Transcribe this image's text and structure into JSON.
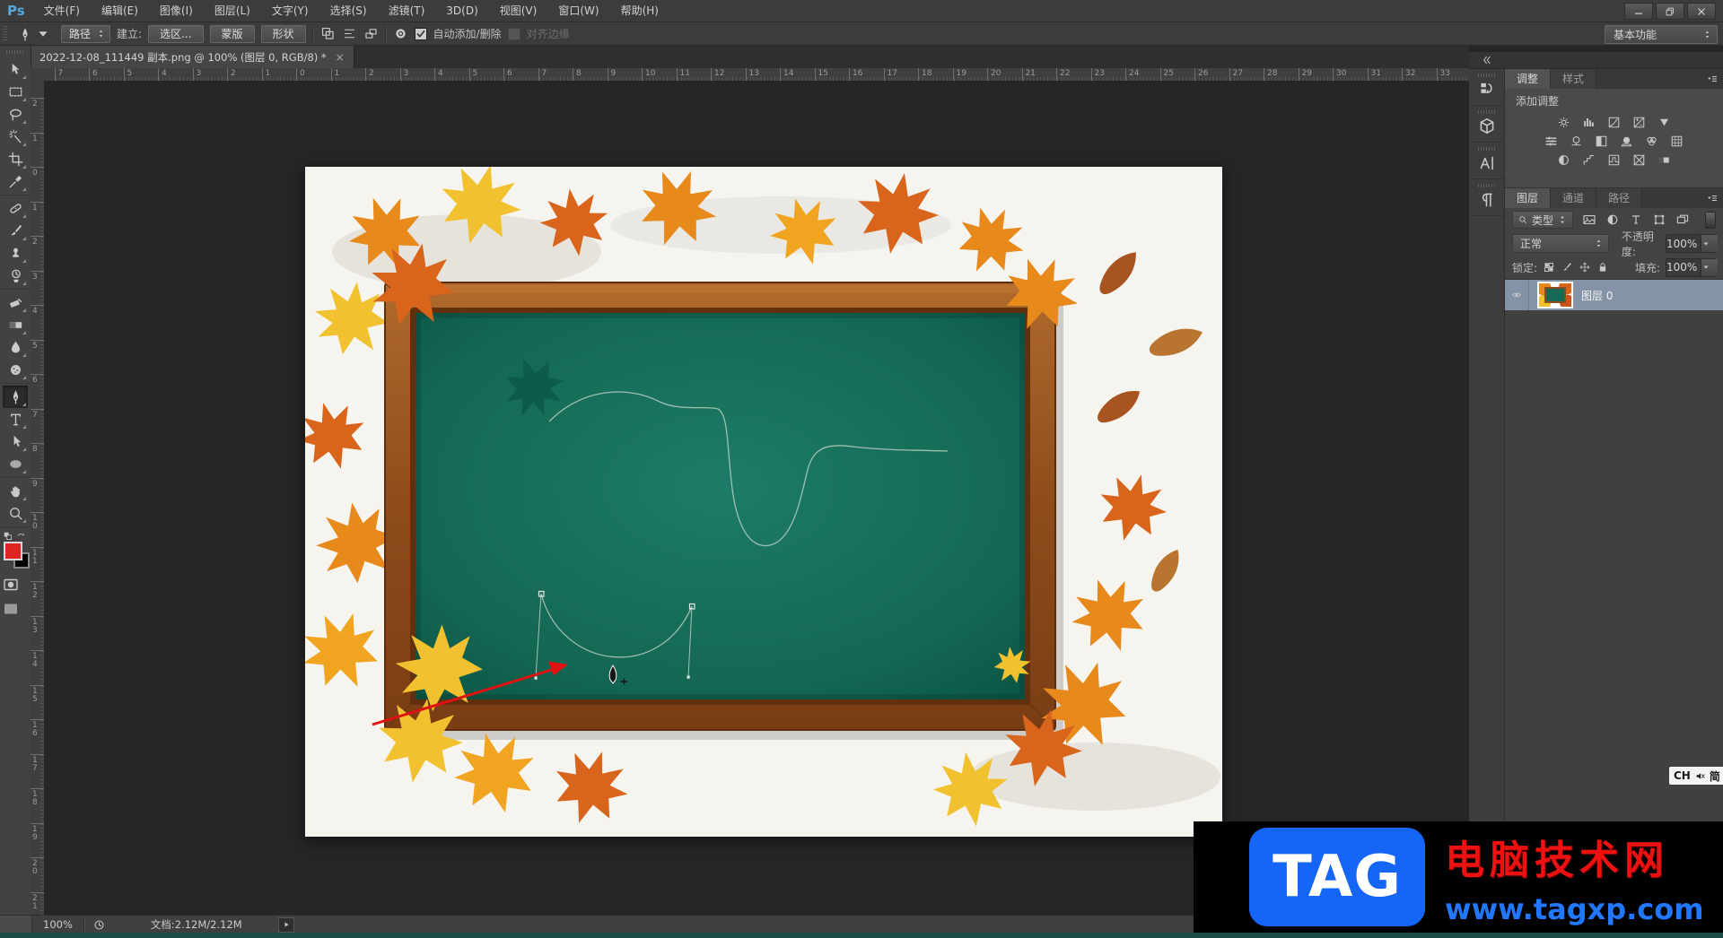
{
  "app": {
    "logo": "Ps",
    "workspace_button": "基本功能"
  },
  "menubar": {
    "items": [
      "文件(F)",
      "编辑(E)",
      "图像(I)",
      "图层(L)",
      "文字(Y)",
      "选择(S)",
      "滤镜(T)",
      "3D(D)",
      "视图(V)",
      "窗口(W)",
      "帮助(H)"
    ]
  },
  "window_controls": {
    "icons": [
      "minimize-icon",
      "restore-icon",
      "close-icon"
    ]
  },
  "options_bar": {
    "tool_mode": "路径",
    "make_label": "建立:",
    "make_selection": "选区...",
    "make_mask": "蒙版",
    "make_shape": "形状",
    "auto_add_delete": "自动添加/删除",
    "auto_add_checked": true,
    "align_edges": "对齐边缘",
    "align_edges_enabled": false
  },
  "document_tab": {
    "title": "2022-12-08_111449 副本.png @ 100% (图层 0, RGB/8) *",
    "close_glyph": "×"
  },
  "rulers": {
    "horizontal": [
      "7",
      "6",
      "5",
      "4",
      "3",
      "2",
      "1",
      "0",
      "1",
      "2",
      "3",
      "4",
      "5",
      "6",
      "7",
      "8",
      "9",
      "10",
      "11",
      "12",
      "13",
      "14",
      "15",
      "16",
      "17",
      "18",
      "19",
      "20",
      "21",
      "22",
      "23",
      "24",
      "25",
      "26",
      "27",
      "28",
      "29",
      "30",
      "31",
      "32",
      "33"
    ],
    "vertical": [
      "2",
      "1",
      "0",
      "1",
      "2",
      "3",
      "4",
      "5",
      "6",
      "7",
      "8",
      "9",
      "10",
      "11",
      "12",
      "13",
      "14",
      "15",
      "16",
      "17",
      "18",
      "19",
      "20",
      "21"
    ]
  },
  "toolbar": {
    "groups": [
      [
        "move",
        "marquee",
        "lasso",
        "wand",
        "crop",
        "eyedropper"
      ],
      [
        "healing",
        "brush",
        "stamp",
        "history"
      ],
      [
        "eraser",
        "gradient",
        "blur",
        "dodge"
      ],
      [
        "pen",
        "type",
        "pathselect",
        "shape"
      ],
      [
        "hand",
        "zoom"
      ]
    ],
    "active_tool": "pen",
    "foreground_color": "#e02525",
    "background_color": "#000000"
  },
  "adjustments_panel": {
    "tabs": [
      "调整",
      "样式"
    ],
    "active_tab": "调整",
    "header": "添加调整",
    "icon_rows": [
      [
        "adjbrightness",
        "adjlevels",
        "adjcurves",
        "adjexposure",
        "adjvibrance"
      ],
      [
        "adjhue",
        "adjcolorbalance",
        "adjbw",
        "adjphotofilter",
        "adjchannelmixer",
        "adjcolorlookup"
      ],
      [
        "adjinvert",
        "adjposterize",
        "adjthreshold",
        "adjselectivecolor",
        "adjgradientmap"
      ]
    ]
  },
  "layers_panel": {
    "tabs": [
      "图层",
      "通道",
      "路径"
    ],
    "active_tab": "图层",
    "filter_label": "类型",
    "blend_mode": "正常",
    "opacity_label": "不透明度:",
    "opacity_value": "100%",
    "lock_label": "锁定:",
    "fill_label": "填充:",
    "fill_value": "100%",
    "layers": [
      {
        "name": "图层 0",
        "visible": true,
        "selected": true
      }
    ]
  },
  "status_bar": {
    "zoom": "100%",
    "doc_label": "文档:2.12M/2.12M"
  },
  "ime_badge": {
    "left": "CH",
    "right": "简"
  },
  "watermark": {
    "logo_text": "TAG",
    "site_name": "电脑技术网",
    "site_url": "www.tagxp.com",
    "logo_bg": "#1566f7",
    "name_color": "#ee1111",
    "url_color": "#2277ff"
  },
  "canvas": {
    "board_color": "#136753",
    "frame_color": "#8e4c1b",
    "background_color": "#f5f4ef"
  }
}
